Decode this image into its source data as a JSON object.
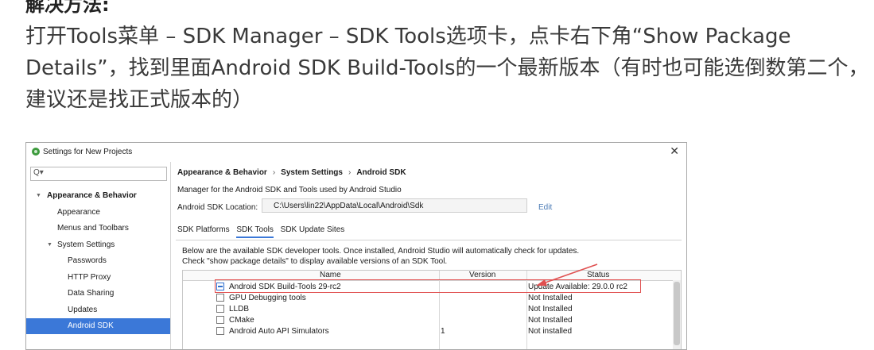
{
  "article": {
    "heading": "解决方法:",
    "paragraph": "打开Tools菜单 – SDK Manager – SDK Tools选项卡，点卡右下角“Show Package Details”，找到里面Android SDK Build-Tools的一个最新版本（有时也可能选倒数第二个，建议还是找正式版本的）"
  },
  "window": {
    "title": "Settings for New Projects",
    "close_icon": "close-icon",
    "app_icon": "android-studio-icon"
  },
  "sidebar": {
    "search_placeholder": "Q▾",
    "items": [
      {
        "label": "Appearance & Behavior",
        "level": 0,
        "expanded": true
      },
      {
        "label": "Appearance",
        "level": 1
      },
      {
        "label": "Menus and Toolbars",
        "level": 1
      },
      {
        "label": "System Settings",
        "level": 1,
        "expanded": true
      },
      {
        "label": "Passwords",
        "level": 2
      },
      {
        "label": "HTTP Proxy",
        "level": 2
      },
      {
        "label": "Data Sharing",
        "level": 2
      },
      {
        "label": "Updates",
        "level": 2
      },
      {
        "label": "Android SDK",
        "level": 2,
        "selected": true
      }
    ]
  },
  "main": {
    "breadcrumb": [
      "Appearance & Behavior",
      "System Settings",
      "Android SDK"
    ],
    "breadcrumb_sep": "›",
    "description": "Manager for the Android SDK and Tools used by Android Studio",
    "location_label": "Android SDK Location:",
    "location_value": "C:\\Users\\lin22\\AppData\\Local\\Android\\Sdk",
    "edit_label": "Edit",
    "tabs": [
      "SDK Platforms",
      "SDK Tools",
      "SDK Update Sites"
    ],
    "active_tab": 1,
    "info": "Below are the available SDK developer tools. Once installed, Android Studio will automatically check for updates. Check \"show package details\" to display available versions of an SDK Tool.",
    "table": {
      "columns": [
        "Name",
        "Version",
        "Status"
      ],
      "rows": [
        {
          "name": "Android SDK Build-Tools 29-rc2",
          "version": "",
          "status": "Update Available: 29.0.0 rc2",
          "check": "partial"
        },
        {
          "name": "GPU Debugging tools",
          "version": "",
          "status": "Not Installed",
          "check": "off"
        },
        {
          "name": "LLDB",
          "version": "",
          "status": "Not Installed",
          "check": "off"
        },
        {
          "name": "CMake",
          "version": "",
          "status": "Not Installed",
          "check": "off"
        },
        {
          "name": "Android Auto API Simulators",
          "version": "1",
          "status": "Not installed",
          "check": "off"
        }
      ]
    }
  },
  "colors": {
    "selection": "#3b78d8",
    "annotation": "#e05050",
    "link": "#4a7ab5"
  }
}
